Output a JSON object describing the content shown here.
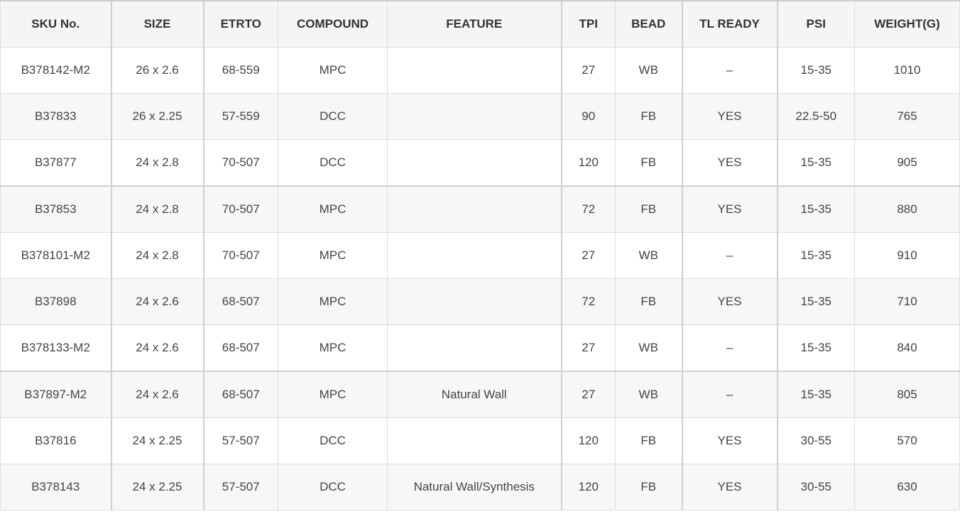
{
  "table": {
    "headers": [
      "SKU No.",
      "SIZE",
      "ETRTO",
      "COMPOUND",
      "FEATURE",
      "TPI",
      "BEAD",
      "TL READY",
      "PSI",
      "WEIGHT(G)"
    ],
    "rows": [
      [
        "B378142-M2",
        "26 x 2.6",
        "68-559",
        "MPC",
        "",
        "27",
        "WB",
        "–",
        "15-35",
        "1010"
      ],
      [
        "B37833",
        "26 x 2.25",
        "57-559",
        "DCC",
        "",
        "90",
        "FB",
        "YES",
        "22.5-50",
        "765"
      ],
      [
        "B37877",
        "24 x 2.8",
        "70-507",
        "DCC",
        "",
        "120",
        "FB",
        "YES",
        "15-35",
        "905"
      ],
      [
        "B37853",
        "24 x 2.8",
        "70-507",
        "MPC",
        "",
        "72",
        "FB",
        "YES",
        "15-35",
        "880"
      ],
      [
        "B378101-M2",
        "24 x 2.8",
        "70-507",
        "MPC",
        "",
        "27",
        "WB",
        "–",
        "15-35",
        "910"
      ],
      [
        "B37898",
        "24 x 2.6",
        "68-507",
        "MPC",
        "",
        "72",
        "FB",
        "YES",
        "15-35",
        "710"
      ],
      [
        "B378133-M2",
        "24 x 2.6",
        "68-507",
        "MPC",
        "",
        "27",
        "WB",
        "–",
        "15-35",
        "840"
      ],
      [
        "B37897-M2",
        "24 x 2.6",
        "68-507",
        "MPC",
        "Natural Wall",
        "27",
        "WB",
        "–",
        "15-35",
        "805"
      ],
      [
        "B37816",
        "24 x 2.25",
        "57-507",
        "DCC",
        "",
        "120",
        "FB",
        "YES",
        "30-55",
        "570"
      ],
      [
        "B378143",
        "24 x 2.25",
        "57-507",
        "DCC",
        "Natural Wall/Synthesis",
        "120",
        "FB",
        "YES",
        "30-55",
        "630"
      ]
    ]
  }
}
